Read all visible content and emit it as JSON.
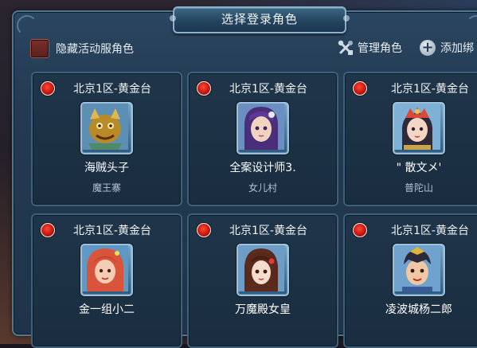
{
  "dialog": {
    "title": "选择登录角色"
  },
  "toolbar": {
    "hide_label": "隐藏活动服角色",
    "hide_checked": false,
    "manage_label": "管理角色",
    "add_label": "添加绑"
  },
  "characters": [
    {
      "server": "北京1区-黄金台",
      "name": "海贼头子",
      "sect": "魔王寨",
      "avatar": "demon-king-avatar-icon"
    },
    {
      "server": "北京1区-黄金台",
      "name": "全案设计师3.",
      "sect": "女儿村",
      "avatar": "purple-hair-girl-avatar-icon"
    },
    {
      "server": "北京1区-黄金台",
      "name": "\" 散文メ'",
      "sect": "普陀山",
      "avatar": "crowned-girl-avatar-icon"
    },
    {
      "server": "北京1区-黄金台",
      "name": "金一组小二",
      "sect": "",
      "avatar": "red-hair-girl-avatar-icon"
    },
    {
      "server": "北京1区-黄金台",
      "name": "万魔殿女皇",
      "sect": "",
      "avatar": "brown-hair-girl-avatar-icon"
    },
    {
      "server": "北京1区-黄金台",
      "name": "凌波城杨二郎",
      "sect": "",
      "avatar": "warrior-boy-avatar-icon"
    }
  ],
  "colors": {
    "panel": "#1f344a",
    "card_border": "#3e6079",
    "radio_red": "#c8170f"
  }
}
